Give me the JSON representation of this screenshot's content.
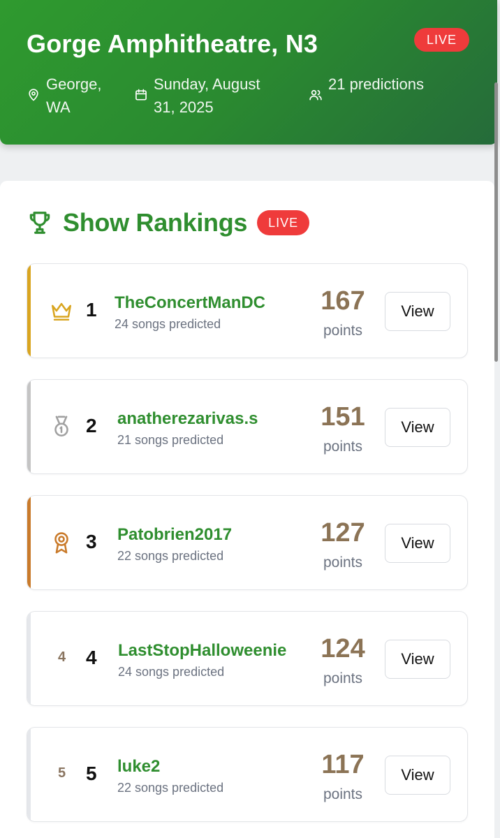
{
  "header": {
    "title": "Gorge Amphitheatre, N3",
    "badge": "LIVE",
    "location": "George, WA",
    "date": "Sunday, August 31, 2025",
    "predictions": "21 predictions",
    "icons": [
      "map-pin-icon",
      "calendar-icon",
      "users-icon"
    ]
  },
  "rankings": {
    "title": "Show Rankings",
    "badge": "LIVE",
    "view_label": "View",
    "points_label": "points",
    "items": [
      {
        "rank": "1",
        "username": "TheConcertManDC",
        "songs": "24 songs predicted",
        "points": "167",
        "icon": "crown-icon",
        "accent": "#d9a520"
      },
      {
        "rank": "2",
        "username": "anatherezarivas.s",
        "songs": "21 songs predicted",
        "points": "151",
        "icon": "medal-icon",
        "accent": "#c4c4c4"
      },
      {
        "rank": "3",
        "username": "Patobrien2017",
        "songs": "22 songs predicted",
        "points": "127",
        "icon": "award-icon",
        "accent": "#c97a2a"
      },
      {
        "rank": "4",
        "username": "LastStopHalloweenie",
        "songs": "24 songs predicted",
        "points": "124",
        "rank_small": "4",
        "accent": "#e5e7eb"
      },
      {
        "rank": "5",
        "username": "luke2",
        "songs": "22 songs predicted",
        "points": "117",
        "rank_small": "5",
        "accent": "#e5e7eb"
      }
    ]
  },
  "colors": {
    "brand_green": "#2f8e2f",
    "live_red": "#ef3b3b",
    "points_brown": "#8b7355"
  }
}
